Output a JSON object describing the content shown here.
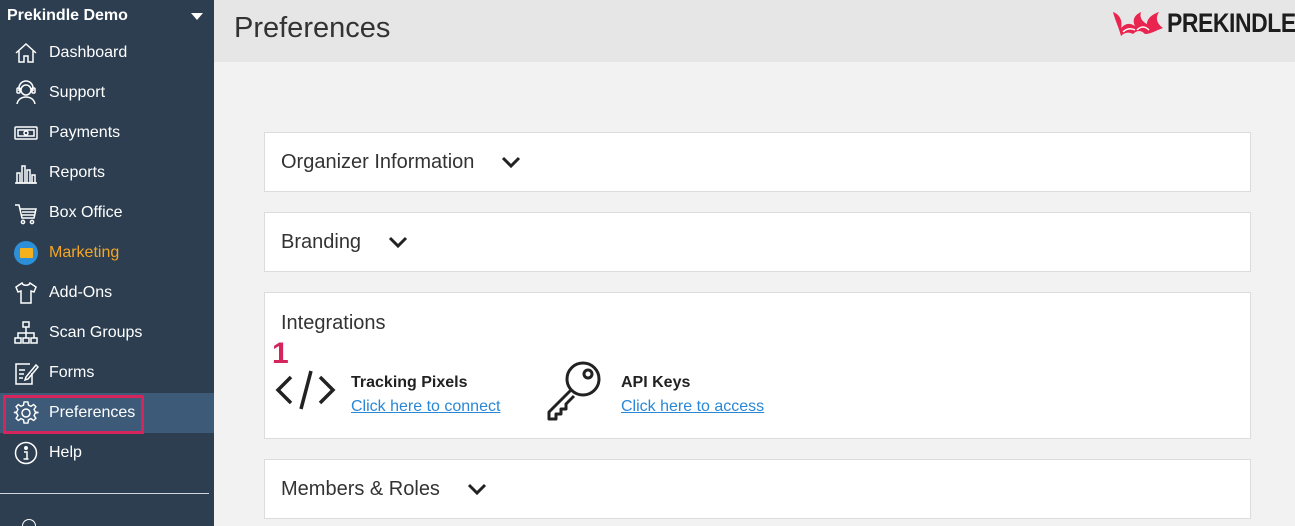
{
  "sidebar": {
    "org_name": "Prekindle Demo",
    "items": [
      {
        "label": "Dashboard",
        "icon": "home-icon"
      },
      {
        "label": "Support",
        "icon": "headset-icon"
      },
      {
        "label": "Payments",
        "icon": "cash-icon"
      },
      {
        "label": "Reports",
        "icon": "bar-chart-icon"
      },
      {
        "label": "Box Office",
        "icon": "cart-icon"
      },
      {
        "label": "Marketing",
        "icon": "envelope-icon"
      },
      {
        "label": "Add-Ons",
        "icon": "shirt-icon"
      },
      {
        "label": "Scan Groups",
        "icon": "hierarchy-icon"
      },
      {
        "label": "Forms",
        "icon": "pencil-form-icon"
      },
      {
        "label": "Preferences",
        "icon": "gear-icon"
      },
      {
        "label": "Help",
        "icon": "info-icon"
      }
    ],
    "active_item": "Preferences"
  },
  "header": {
    "title": "Preferences",
    "logo_text": "PREKINDLE"
  },
  "panels": {
    "organizer": {
      "title": "Organizer Information"
    },
    "branding": {
      "title": "Branding"
    },
    "integrations": {
      "title": "Integrations",
      "step_number": "1",
      "tracking": {
        "label": "Tracking Pixels",
        "link": "Click here to connect"
      },
      "api": {
        "label": "API Keys",
        "link": "Click here to access"
      }
    },
    "members": {
      "title": "Members & Roles"
    }
  },
  "colors": {
    "sidebar_bg": "#2c3e50",
    "active_bg": "#3d5a78",
    "highlight": "#d6245c",
    "marketing": "#f5a623",
    "link": "#2a87d6"
  }
}
